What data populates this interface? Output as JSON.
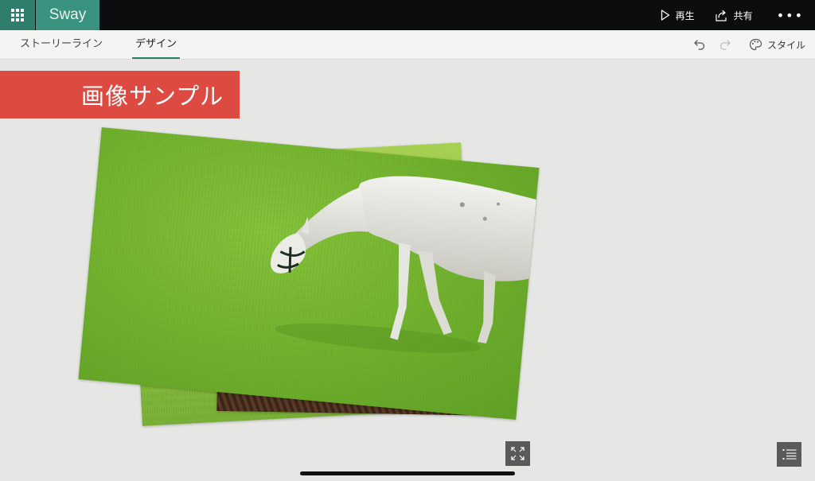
{
  "app": {
    "name": "Sway",
    "accent_color": "#2f7e6d",
    "brand_color": "#3a9280"
  },
  "topbar": {
    "play_label": "再生",
    "share_label": "共有",
    "more_icon": "more-horizontal-icon"
  },
  "tabs": [
    {
      "label": "ストーリーライン",
      "active": false
    },
    {
      "label": "デザイン",
      "active": true
    }
  ],
  "toolbar": {
    "undo_icon": "undo-icon",
    "redo_icon": "redo-icon",
    "style_label": "スタイル"
  },
  "canvas": {
    "title": "画像サンプル",
    "title_color": "#dc4a41",
    "images": [
      {
        "name": "grass-photo",
        "subject": "grass"
      },
      {
        "name": "soil-photo",
        "subject": "soil"
      },
      {
        "name": "llama-photo",
        "subject": "white llama grazing on grass"
      }
    ]
  }
}
